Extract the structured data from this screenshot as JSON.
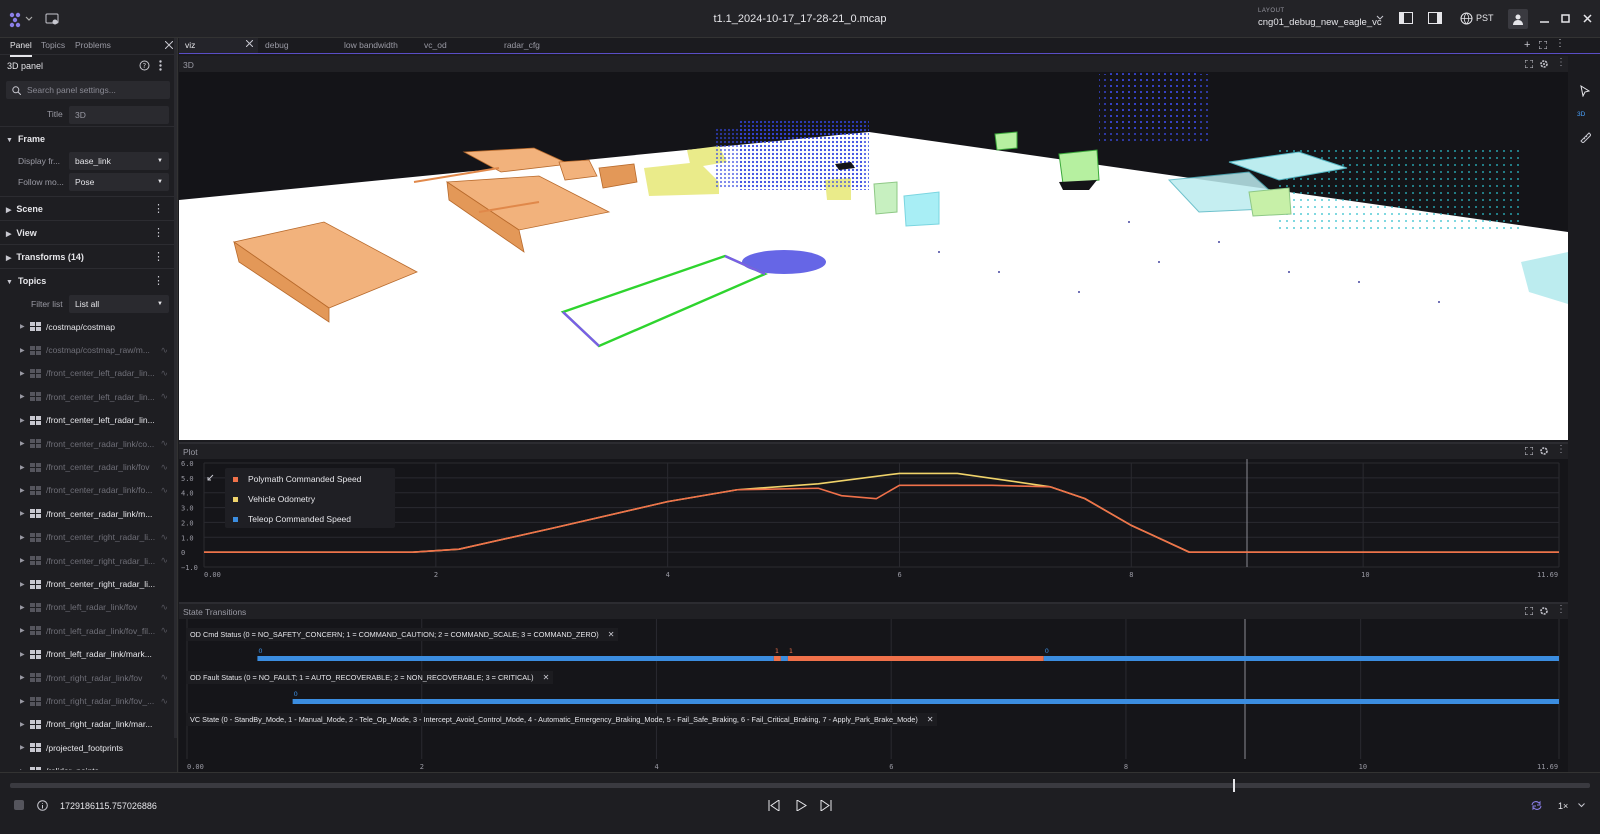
{
  "titlebar": {
    "file_title": "t1.1_2024-10-17_17-28-21_0.mcap",
    "layout_label": "LAYOUT",
    "layout_name": "cng01_debug_new_eagle_vc",
    "timezone": "PST"
  },
  "sidebar": {
    "tabs": [
      "Panel",
      "Topics",
      "Problems"
    ],
    "panel_title": "3D panel",
    "search_placeholder": "Search panel settings...",
    "title_label": "Title",
    "title_value": "3D",
    "frame_section": "Frame",
    "display_frame_label": "Display fr...",
    "display_frame_value": "base_link",
    "follow_mode_label": "Follow mo...",
    "follow_mode_value": "Pose",
    "scene_section": "Scene",
    "view_section": "View",
    "transforms_section": "Transforms (14)",
    "topics_section": "Topics",
    "filter_label": "Filter list",
    "filter_value": "List all",
    "topics": [
      {
        "name": "/costmap/costmap",
        "dim": false
      },
      {
        "name": "/costmap/costmap_raw/m...",
        "dim": true
      },
      {
        "name": "/front_center_left_radar_lin...",
        "dim": true
      },
      {
        "name": "/front_center_left_radar_lin...",
        "dim": true
      },
      {
        "name": "/front_center_left_radar_lin...",
        "dim": false
      },
      {
        "name": "/front_center_radar_link/co...",
        "dim": true
      },
      {
        "name": "/front_center_radar_link/fov",
        "dim": true
      },
      {
        "name": "/front_center_radar_link/fo...",
        "dim": true
      },
      {
        "name": "/front_center_radar_link/m...",
        "dim": false
      },
      {
        "name": "/front_center_right_radar_li...",
        "dim": true
      },
      {
        "name": "/front_center_right_radar_li...",
        "dim": true
      },
      {
        "name": "/front_center_right_radar_li...",
        "dim": false
      },
      {
        "name": "/front_left_radar_link/fov",
        "dim": true
      },
      {
        "name": "/front_left_radar_link/fov_fil...",
        "dim": true
      },
      {
        "name": "/front_left_radar_link/mark...",
        "dim": false
      },
      {
        "name": "/front_right_radar_link/fov",
        "dim": true
      },
      {
        "name": "/front_right_radar_link/fov_...",
        "dim": true
      },
      {
        "name": "/front_right_radar_link/mar...",
        "dim": false
      },
      {
        "name": "/projected_footprints",
        "dim": false
      },
      {
        "name": "/rslidar_points",
        "dim": false
      }
    ]
  },
  "panel_tabs": [
    "viz",
    "debug",
    "low bandwidth",
    "vc_od",
    "radar_cfg"
  ],
  "panel3d": {
    "title": "3D",
    "badge_3d": "3D"
  },
  "plot": {
    "title": "Plot"
  },
  "state": {
    "title": "State Transitions"
  },
  "bottom": {
    "timestamp": "1729186115.757026886",
    "speed": "1×"
  },
  "colors": {
    "accent": "#5a4ec6",
    "orange": "#f0714a",
    "blue": "#3b8de0",
    "yellow": "#f0d36a",
    "green": "#3ddc3d"
  },
  "chart_data": [
    {
      "type": "line",
      "title": "Plot",
      "x_ticks": [
        "0.00",
        "2",
        "4",
        "6",
        "8",
        "10",
        "11.69"
      ],
      "y_ticks": [
        "6.0",
        "5.0",
        "4.0",
        "3.0",
        "2.0",
        "1.0",
        "0",
        "−1.0"
      ],
      "xlim": [
        0,
        11.69
      ],
      "ylim": [
        -1.0,
        6.0
      ],
      "grid": true,
      "legend_position": "top-left",
      "series": [
        {
          "name": "Polymath Commanded Speed",
          "color": "#f0714a",
          "x": [
            0,
            1.8,
            2.2,
            3,
            4,
            4.6,
            5.3,
            5.5,
            5.8,
            6,
            6.8,
            7.3,
            7.6,
            8.0,
            8.5,
            9,
            11.69
          ],
          "y": [
            0,
            0,
            0.2,
            1.6,
            3.4,
            4.2,
            4.3,
            3.8,
            3.6,
            4.5,
            4.5,
            4.4,
            3.6,
            1.8,
            0,
            0,
            0
          ]
        },
        {
          "name": "Vehicle Odometry",
          "color": "#f0d36a",
          "x": [
            0,
            1.8,
            2.2,
            3,
            4,
            4.6,
            5.3,
            6,
            6.5,
            7.3,
            7.6,
            8.0,
            8.5,
            9,
            11.69
          ],
          "y": [
            0,
            0,
            0.2,
            1.6,
            3.4,
            4.2,
            4.6,
            5.3,
            5.3,
            4.4,
            3.6,
            1.8,
            0,
            0,
            0
          ]
        },
        {
          "name": "Teleop Commanded Speed",
          "color": "#3b8de0",
          "x": [],
          "y": []
        }
      ]
    },
    {
      "type": "state-transitions",
      "title": "State Transitions",
      "x_ticks": [
        "0.00",
        "2",
        "4",
        "6",
        "8",
        "10",
        "11.69"
      ],
      "xlim": [
        0,
        11.69
      ],
      "rows": [
        {
          "label": "OD Cmd Status (0 = NO_SAFETY_CONCERN; 1 = COMMAND_CAUTION; 2 = COMMAND_SCALE; 3 = COMMAND_ZERO)",
          "segments": [
            {
              "start": 0.6,
              "end": 5.0,
              "value": "0",
              "color": "#3b8de0"
            },
            {
              "start": 5.0,
              "end": 5.06,
              "value": "1",
              "color": "#f0714a"
            },
            {
              "start": 5.06,
              "end": 5.12,
              "value": "",
              "color": "#3b8de0"
            },
            {
              "start": 5.12,
              "end": 7.3,
              "value": "1",
              "color": "#f0714a"
            },
            {
              "start": 7.3,
              "end": 11.69,
              "value": "0",
              "color": "#3b8de0"
            }
          ]
        },
        {
          "label": "OD Fault Status (0 = NO_FAULT; 1 = AUTO_RECOVERABLE; 2 = NON_RECOVERABLE; 3 = CRITICAL)",
          "segments": [
            {
              "start": 0.9,
              "end": 11.69,
              "value": "0",
              "color": "#3b8de0"
            }
          ]
        },
        {
          "label": "VC State (0 - StandBy_Mode, 1 - Manual_Mode, 2 - Tele_Op_Mode, 3 - Intercept_Avoid_Control_Mode, 4 - Automatic_Emergency_Braking_Mode, 5 - Fail_Safe_Braking, 6 - Fail_Critical_Braking, 7 - Apply_Park_Brake_Mode)",
          "segments": []
        }
      ]
    }
  ]
}
